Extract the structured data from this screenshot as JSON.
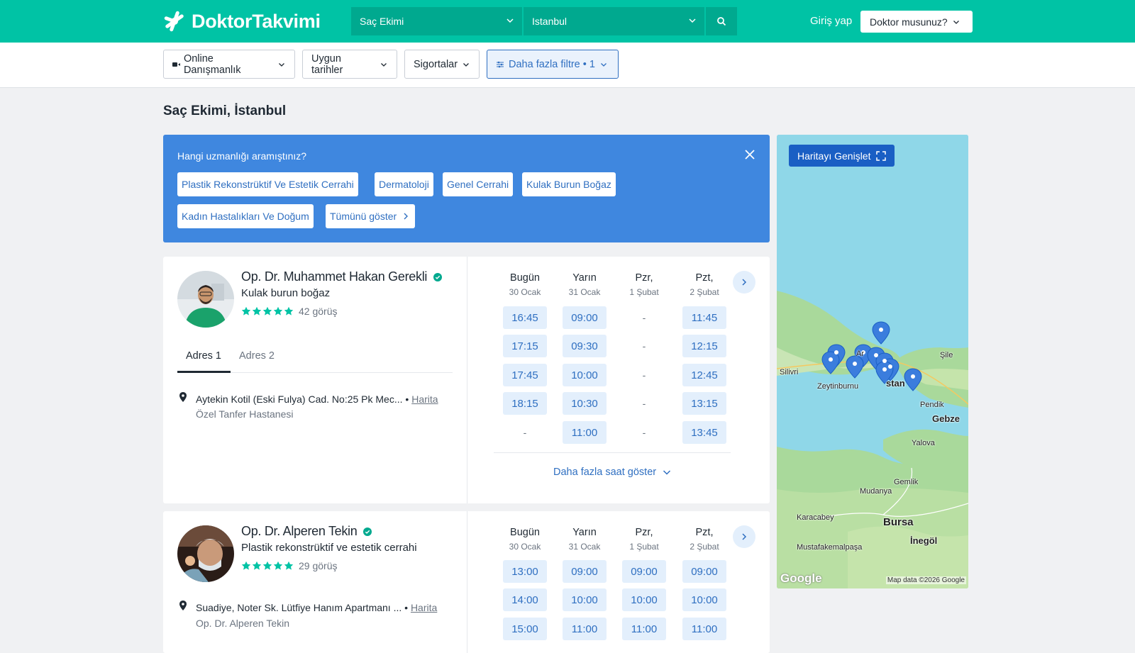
{
  "brand": {
    "name": "DoktorTakvimi",
    "accent": "#00c3a5",
    "accent_dark": "#00a98f",
    "link": "#2f6fc1"
  },
  "search": {
    "specialty": "Saç Ekimi",
    "city": "Istanbul"
  },
  "header": {
    "login": "Giriş yap",
    "doctor_menu": "Doktor musunuz?"
  },
  "filters": {
    "online": "Online Danışmanlık",
    "dates": "Uygun tarihler",
    "insurance": "Sigortalar",
    "more": "Daha fazla filtre • 1"
  },
  "page_title": "Saç Ekimi, İstanbul",
  "specialty_prompt": {
    "question": "Hangi uzmanlığı aramıştınız?",
    "chips": [
      "Plastik Rekonstrüktif Ve Estetik Cerrahi",
      "Dermatoloji",
      "Genel Cerrahi",
      "Kulak Burun Boğaz",
      "Kadın Hastalıkları Ve Doğum"
    ],
    "show_all": "Tümünü göster"
  },
  "days": [
    {
      "label": "Bugün",
      "date": "30 Ocak"
    },
    {
      "label": "Yarın",
      "date": "31 Ocak"
    },
    {
      "label": "Pzr,",
      "date": "1 Şubat"
    },
    {
      "label": "Pzt,",
      "date": "2 Şubat"
    }
  ],
  "doctors": [
    {
      "name": "Op. Dr. Muhammet Hakan Gerekli",
      "specialty": "Kulak burun boğaz",
      "reviews": "42 görüş",
      "tabs": [
        "Adres 1",
        "Adres 2"
      ],
      "address": "Aytekin Kotil (Eski Fulya) Cad. No:25 Pk Mec...",
      "map_link": "Harita",
      "place": "Özel Tanfer Hastanesi",
      "slots": [
        [
          "16:45",
          "17:15",
          "17:45",
          "18:15",
          "-"
        ],
        [
          "09:00",
          "09:30",
          "10:00",
          "10:30",
          "11:00"
        ],
        [
          "-",
          "-",
          "-",
          "-",
          "-"
        ],
        [
          "11:45",
          "12:15",
          "12:45",
          "13:15",
          "13:45"
        ]
      ],
      "more_times": "Daha fazla saat göster"
    },
    {
      "name": "Op. Dr. Alperen Tekin",
      "specialty": "Plastik rekonstrüktif ve estetik cerrahi",
      "reviews": "29 görüş",
      "address": "Suadiye, Noter Sk. Lütfiye Hanım Apartmanı ...",
      "map_link": "Harita",
      "place": "Op. Dr. Alperen Tekin",
      "slots": [
        [
          "13:00",
          "14:00",
          "15:00"
        ],
        [
          "09:00",
          "10:00",
          "11:00"
        ],
        [
          "09:00",
          "10:00",
          "11:00"
        ],
        [
          "09:00",
          "10:00",
          "11:00"
        ]
      ]
    }
  ],
  "map": {
    "expand": "Haritayı Genişlet",
    "labels": [
      "Silivri",
      "Zeytinburnu",
      "Ar",
      "Şile",
      "Pendik",
      "Gebze",
      "Yalova",
      "Gemlik",
      "Mudanya",
      "Karacabey",
      "Bursa",
      "İnegöl",
      "Mustafakemalpaşa",
      "stan"
    ],
    "provider": "Google",
    "attribution": "Map data ©2026 Google"
  }
}
